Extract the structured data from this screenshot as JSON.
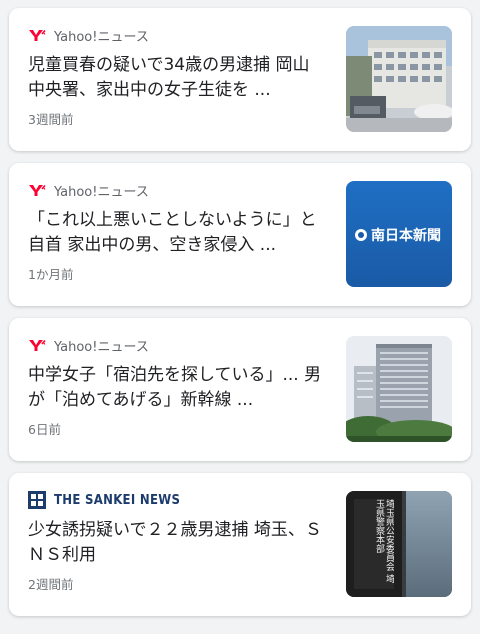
{
  "articles": [
    {
      "source": "Yahoo!ニュース",
      "source_icon": "yahoo-y-icon",
      "headline": "児童買春の疑いで34歳の男逮捕 岡山中央署、家出中の女子生徒を ...",
      "time": "3週間前",
      "thumbnail": "police-building-photo"
    },
    {
      "source": "Yahoo!ニュース",
      "source_icon": "yahoo-y-icon",
      "headline": "「これ以上悪いことしないように」と自首 家出中の男、空き家侵入 ...",
      "time": "1か月前",
      "thumbnail": "minami-nippon-shimbun-logo",
      "thumbnail_text": "南日本新聞"
    },
    {
      "source": "Yahoo!ニュース",
      "source_icon": "yahoo-y-icon",
      "headline": "中学女子「宿泊先を探している」... 男が「泊めてあげる」新幹線 ...",
      "time": "6日前",
      "thumbnail": "office-tower-photo"
    },
    {
      "source": "THE SANKEI NEWS",
      "source_icon": "sankei-logo-icon",
      "headline": "少女誘拐疑いで２２歳男逮捕 埼玉、ＳＮＳ利用",
      "time": "2週間前",
      "thumbnail": "saitama-police-sign-photo",
      "thumbnail_text": "埼玉県公安委員会 埼玉県警察本部"
    }
  ],
  "colors": {
    "yahoo_red": "#ff0033",
    "sankei_navy": "#1c3c6e",
    "text": "#202124",
    "meta": "#70757a"
  }
}
